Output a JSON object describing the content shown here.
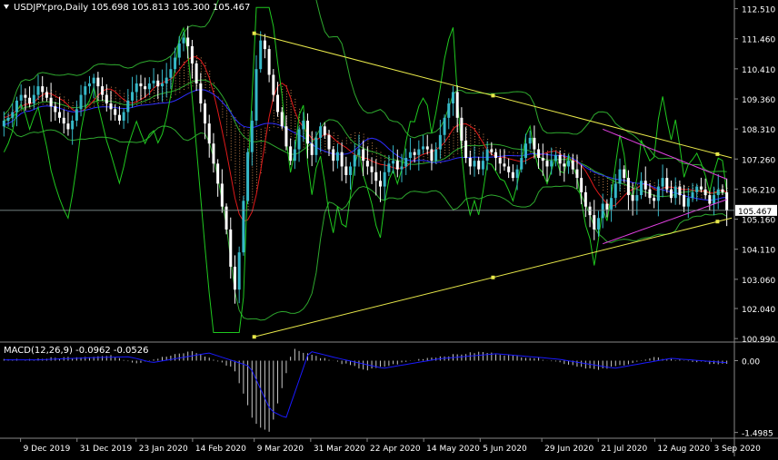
{
  "symbol_header": "USDJPY.pro,Daily  105.698 105.813 105.300 105.467",
  "macd_header": "MACD(12,26,9) -0.0962 -0.0526",
  "current_price_label": "105.467",
  "colors": {
    "background": "#000000",
    "bull_candle": "#36b8c8",
    "bear_candle": "#ffffff",
    "trendline": "#e8e84a",
    "bollinger": "#2ea82e",
    "ma_red": "#e11a1a",
    "ma_blue": "#2d2dff",
    "ichimoku_cloud": "#f4a460",
    "recent_channel": "#e040e0",
    "oscillator": "#1fc81f",
    "macd_hist": "#c8c8c8",
    "macd_signal": "#1a1aff"
  },
  "chart_data": [
    {
      "type": "candlestick",
      "symbol": "USDJPY.pro",
      "timeframe": "Daily",
      "ohlc_last": {
        "open": 105.698,
        "high": 105.813,
        "low": 105.3,
        "close": 105.467
      },
      "y_tick_labels": [
        "112.510",
        "111.460",
        "110.410",
        "109.360",
        "108.310",
        "107.260",
        "106.210",
        "105.160",
        "104.110",
        "103.060",
        "102.040",
        "100.990"
      ],
      "x_tick_labels": [
        "9 Dec 2019",
        "31 Dec 2019",
        "23 Jan 2020",
        "14 Feb 2020",
        "9 Mar 2020",
        "31 Mar 2020",
        "22 Apr 2020",
        "14 May 2020",
        "5 Jun 2020",
        "29 Jun 2020",
        "21 Jul 2020",
        "12 Aug 2020",
        "3 Sep 2020"
      ],
      "ylim": [
        100.9,
        112.75
      ],
      "closes": [
        108.6,
        108.7,
        108.9,
        109.3,
        109.5,
        109.4,
        109.2,
        109.5,
        109.8,
        109.6,
        109.4,
        109.1,
        108.9,
        108.7,
        108.5,
        108.3,
        108.6,
        109.0,
        109.5,
        109.8,
        109.9,
        110.1,
        109.8,
        109.5,
        109.2,
        109.0,
        108.8,
        108.6,
        108.9,
        109.3,
        109.6,
        109.9,
        109.8,
        109.7,
        109.9,
        110.0,
        109.8,
        109.9,
        110.1,
        110.4,
        110.8,
        111.3,
        111.5,
        111.2,
        110.6,
        109.9,
        109.2,
        108.5,
        107.8,
        107.1,
        106.4,
        105.6,
        104.8,
        103.5,
        102.7,
        104.0,
        105.8,
        107.5,
        108.6,
        110.4,
        111.4,
        111.1,
        110.2,
        109.5,
        108.9,
        108.4,
        107.7,
        107.2,
        107.6,
        108.3,
        108.6,
        107.8,
        107.4,
        108.0,
        108.4,
        108.1,
        107.6,
        107.2,
        107.5,
        107.0,
        106.7,
        107.0,
        107.4,
        107.6,
        107.2,
        107.0,
        106.8,
        106.5,
        106.3,
        106.8,
        107.1,
        107.2,
        106.9,
        107.0,
        107.3,
        107.5,
        107.4,
        107.6,
        107.7,
        107.6,
        107.2,
        107.6,
        108.1,
        108.7,
        109.2,
        109.6,
        108.7,
        107.9,
        107.3,
        107.0,
        107.2,
        106.9,
        107.2,
        107.6,
        107.5,
        107.3,
        107.1,
        107.0,
        106.8,
        106.6,
        106.9,
        107.3,
        107.8,
        108.0,
        107.6,
        107.3,
        107.2,
        107.0,
        107.2,
        107.4,
        107.1,
        107.0,
        107.2,
        106.9,
        106.6,
        106.1,
        105.6,
        105.3,
        104.8,
        105.2,
        105.7,
        105.5,
        105.9,
        106.4,
        106.9,
        106.6,
        106.0,
        105.8,
        106.0,
        106.5,
        106.2,
        105.9,
        105.8,
        106.3,
        106.6,
        106.2,
        105.9,
        106.3,
        106.0,
        105.6,
        105.9,
        106.1,
        106.3,
        106.2,
        106.0,
        105.7,
        106.0,
        106.2,
        106.1,
        105.467
      ],
      "trendlines": [
        {
          "name": "upper",
          "points": [
            [
              "2020-03-09",
              111.65
            ],
            [
              "2020-09-11",
              107.3
            ]
          ]
        },
        {
          "name": "lower",
          "points": [
            [
              "2020-03-09",
              101.05
            ],
            [
              "2020-09-11",
              105.2
            ]
          ]
        }
      ],
      "price_line": 105.467
    },
    {
      "type": "histogram",
      "indicator": "MACD",
      "params": [
        12,
        26,
        9
      ],
      "values_last": {
        "macd": -0.0962,
        "signal": -0.0526
      },
      "y_tick_labels": [
        "0.00",
        "-1.4985"
      ],
      "ylim": [
        -1.6,
        0.35
      ],
      "histogram_shape": [
        [
          "2019-12-09",
          0.02
        ],
        [
          "2019-12-31",
          0.08
        ],
        [
          "2020-01-14",
          0.1
        ],
        [
          "2020-01-23",
          -0.05
        ],
        [
          "2020-02-14",
          0.2
        ],
        [
          "2020-03-01",
          -0.15
        ],
        [
          "2020-03-09",
          -1.3
        ],
        [
          "2020-03-15",
          -1.5
        ],
        [
          "2020-03-24",
          0.25
        ],
        [
          "2020-04-05",
          0.05
        ],
        [
          "2020-04-22",
          -0.2
        ],
        [
          "2020-05-14",
          0.05
        ],
        [
          "2020-06-05",
          0.18
        ],
        [
          "2020-06-29",
          0.04
        ],
        [
          "2020-07-21",
          -0.2
        ],
        [
          "2020-08-12",
          0.06
        ],
        [
          "2020-09-11",
          -0.0962
        ]
      ]
    }
  ]
}
